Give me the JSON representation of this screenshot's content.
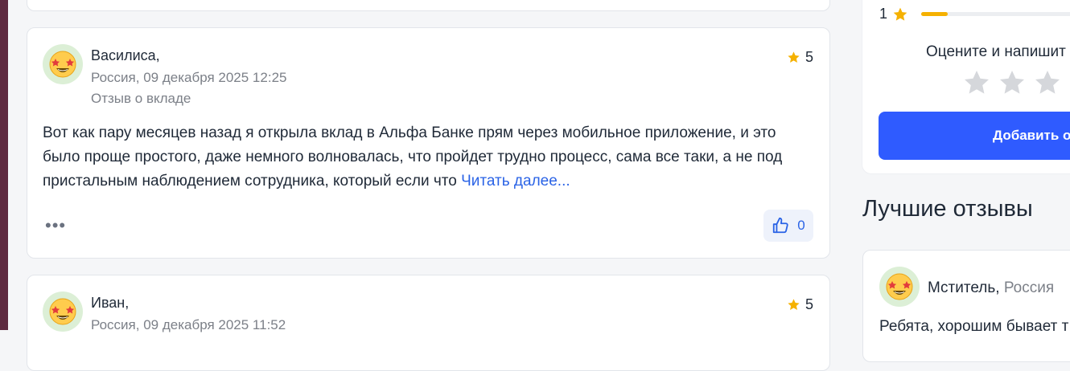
{
  "reviews": [
    {
      "author": "Василиса,",
      "meta": "Россия, 09 декабря 2025 12:25",
      "subject": "Отзыв о вкладе",
      "rating": "5",
      "text": "Вот как пару месяцев назад я открыла вклад в Альфа Банке прям через мобильное приложение, и это было проще простого, даже немного волновалась, что пройдет трудно процесс, сама все таки, а не под пристальным наблюдением сотрудника, который если что ",
      "read_more": "Читать далее...",
      "more_menu": "•••",
      "likes": "0"
    },
    {
      "author": "Иван,",
      "meta": "Россия, 09 декабря 2025 11:52",
      "rating": "5"
    }
  ],
  "sidebar": {
    "rating_row": {
      "stars": "1",
      "fill_fraction": 0.15
    },
    "rate_prompt": "Оцените и напишит",
    "add_button": "Добавить о",
    "best_title": "Лучшие отзывы",
    "best_review": {
      "author": "Мститель,",
      "country": "Россия",
      "text": "Ребята, хорошим бывает т"
    }
  },
  "colors": {
    "accent": "#2f5bff",
    "link": "#2a63e6",
    "star": "#f5b100",
    "star_empty": "#d5d7db"
  },
  "icons": {
    "avatar": "star-struck-emoji-icon",
    "rating": "star-icon",
    "like": "thumbs-up-icon"
  }
}
